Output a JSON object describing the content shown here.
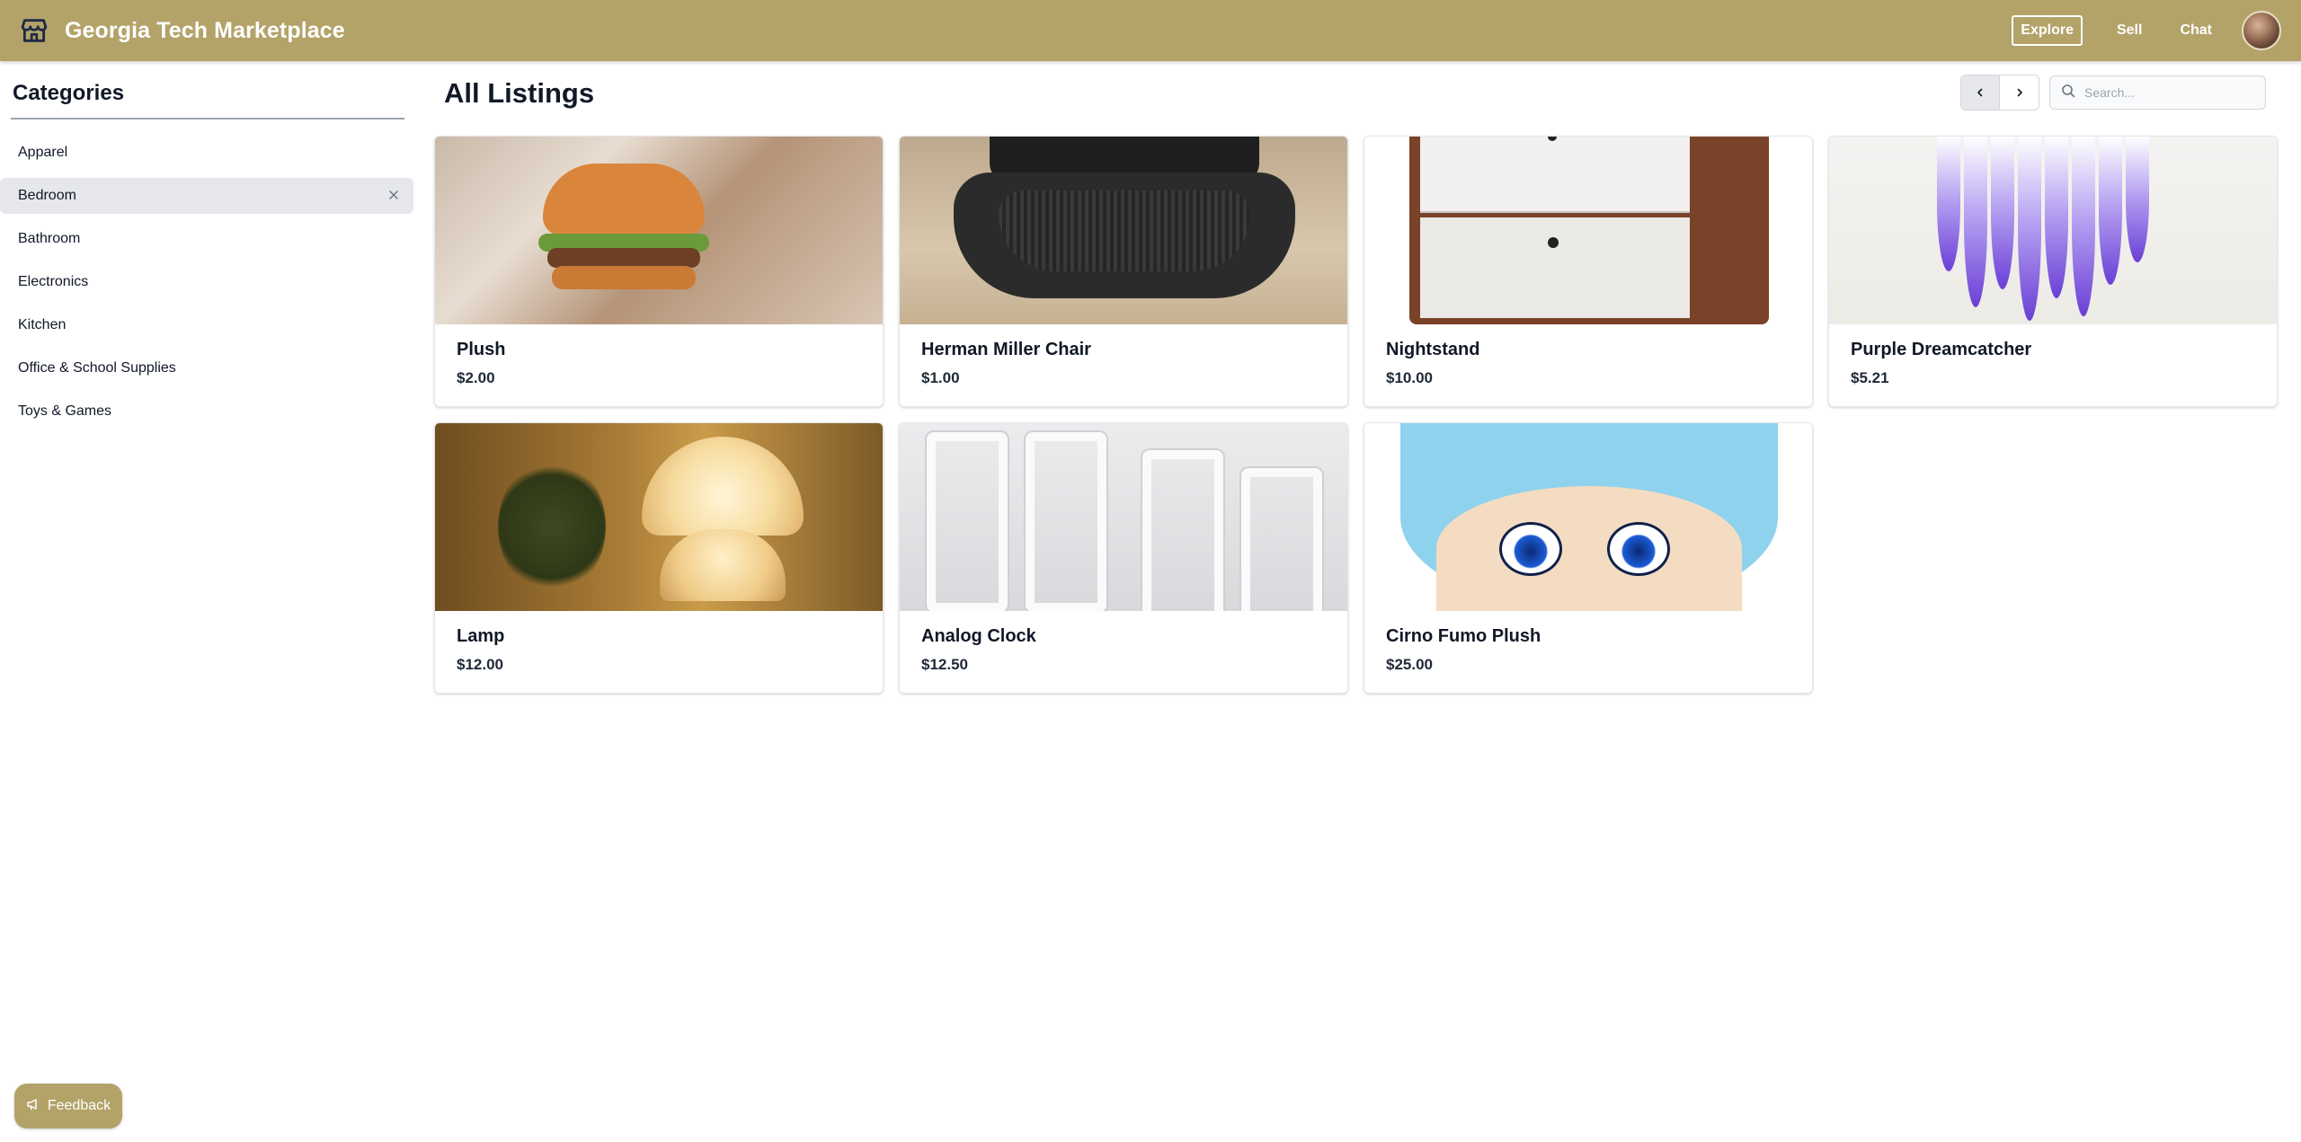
{
  "header": {
    "title": "Georgia Tech Marketplace",
    "logo_icon": "storefront-icon",
    "nav": {
      "explore": "Explore",
      "sell": "Sell",
      "chat": "Chat"
    },
    "colors": {
      "brand": "#b3a369",
      "text": "#ffffff"
    }
  },
  "sidebar": {
    "title": "Categories",
    "items": [
      {
        "label": "Apparel"
      },
      {
        "label": "Bedroom",
        "selected": true
      },
      {
        "label": "Bathroom"
      },
      {
        "label": "Electronics"
      },
      {
        "label": "Kitchen"
      },
      {
        "label": "Office & School Supplies"
      },
      {
        "label": "Toys & Games"
      }
    ]
  },
  "main": {
    "title": "All Listings",
    "search": {
      "placeholder": "Search...",
      "value": ""
    },
    "listings": [
      {
        "name": "Plush",
        "price": "$2.00"
      },
      {
        "name": "Herman Miller Chair",
        "price": "$1.00"
      },
      {
        "name": "Nightstand",
        "price": "$10.00"
      },
      {
        "name": "Purple Dreamcatcher",
        "price": "$5.21"
      },
      {
        "name": "Lamp",
        "price": "$12.00"
      },
      {
        "name": "Analog Clock",
        "price": "$12.50"
      },
      {
        "name": "Cirno Fumo Plush",
        "price": "$25.00"
      }
    ]
  },
  "feedback": {
    "label": "Feedback"
  }
}
